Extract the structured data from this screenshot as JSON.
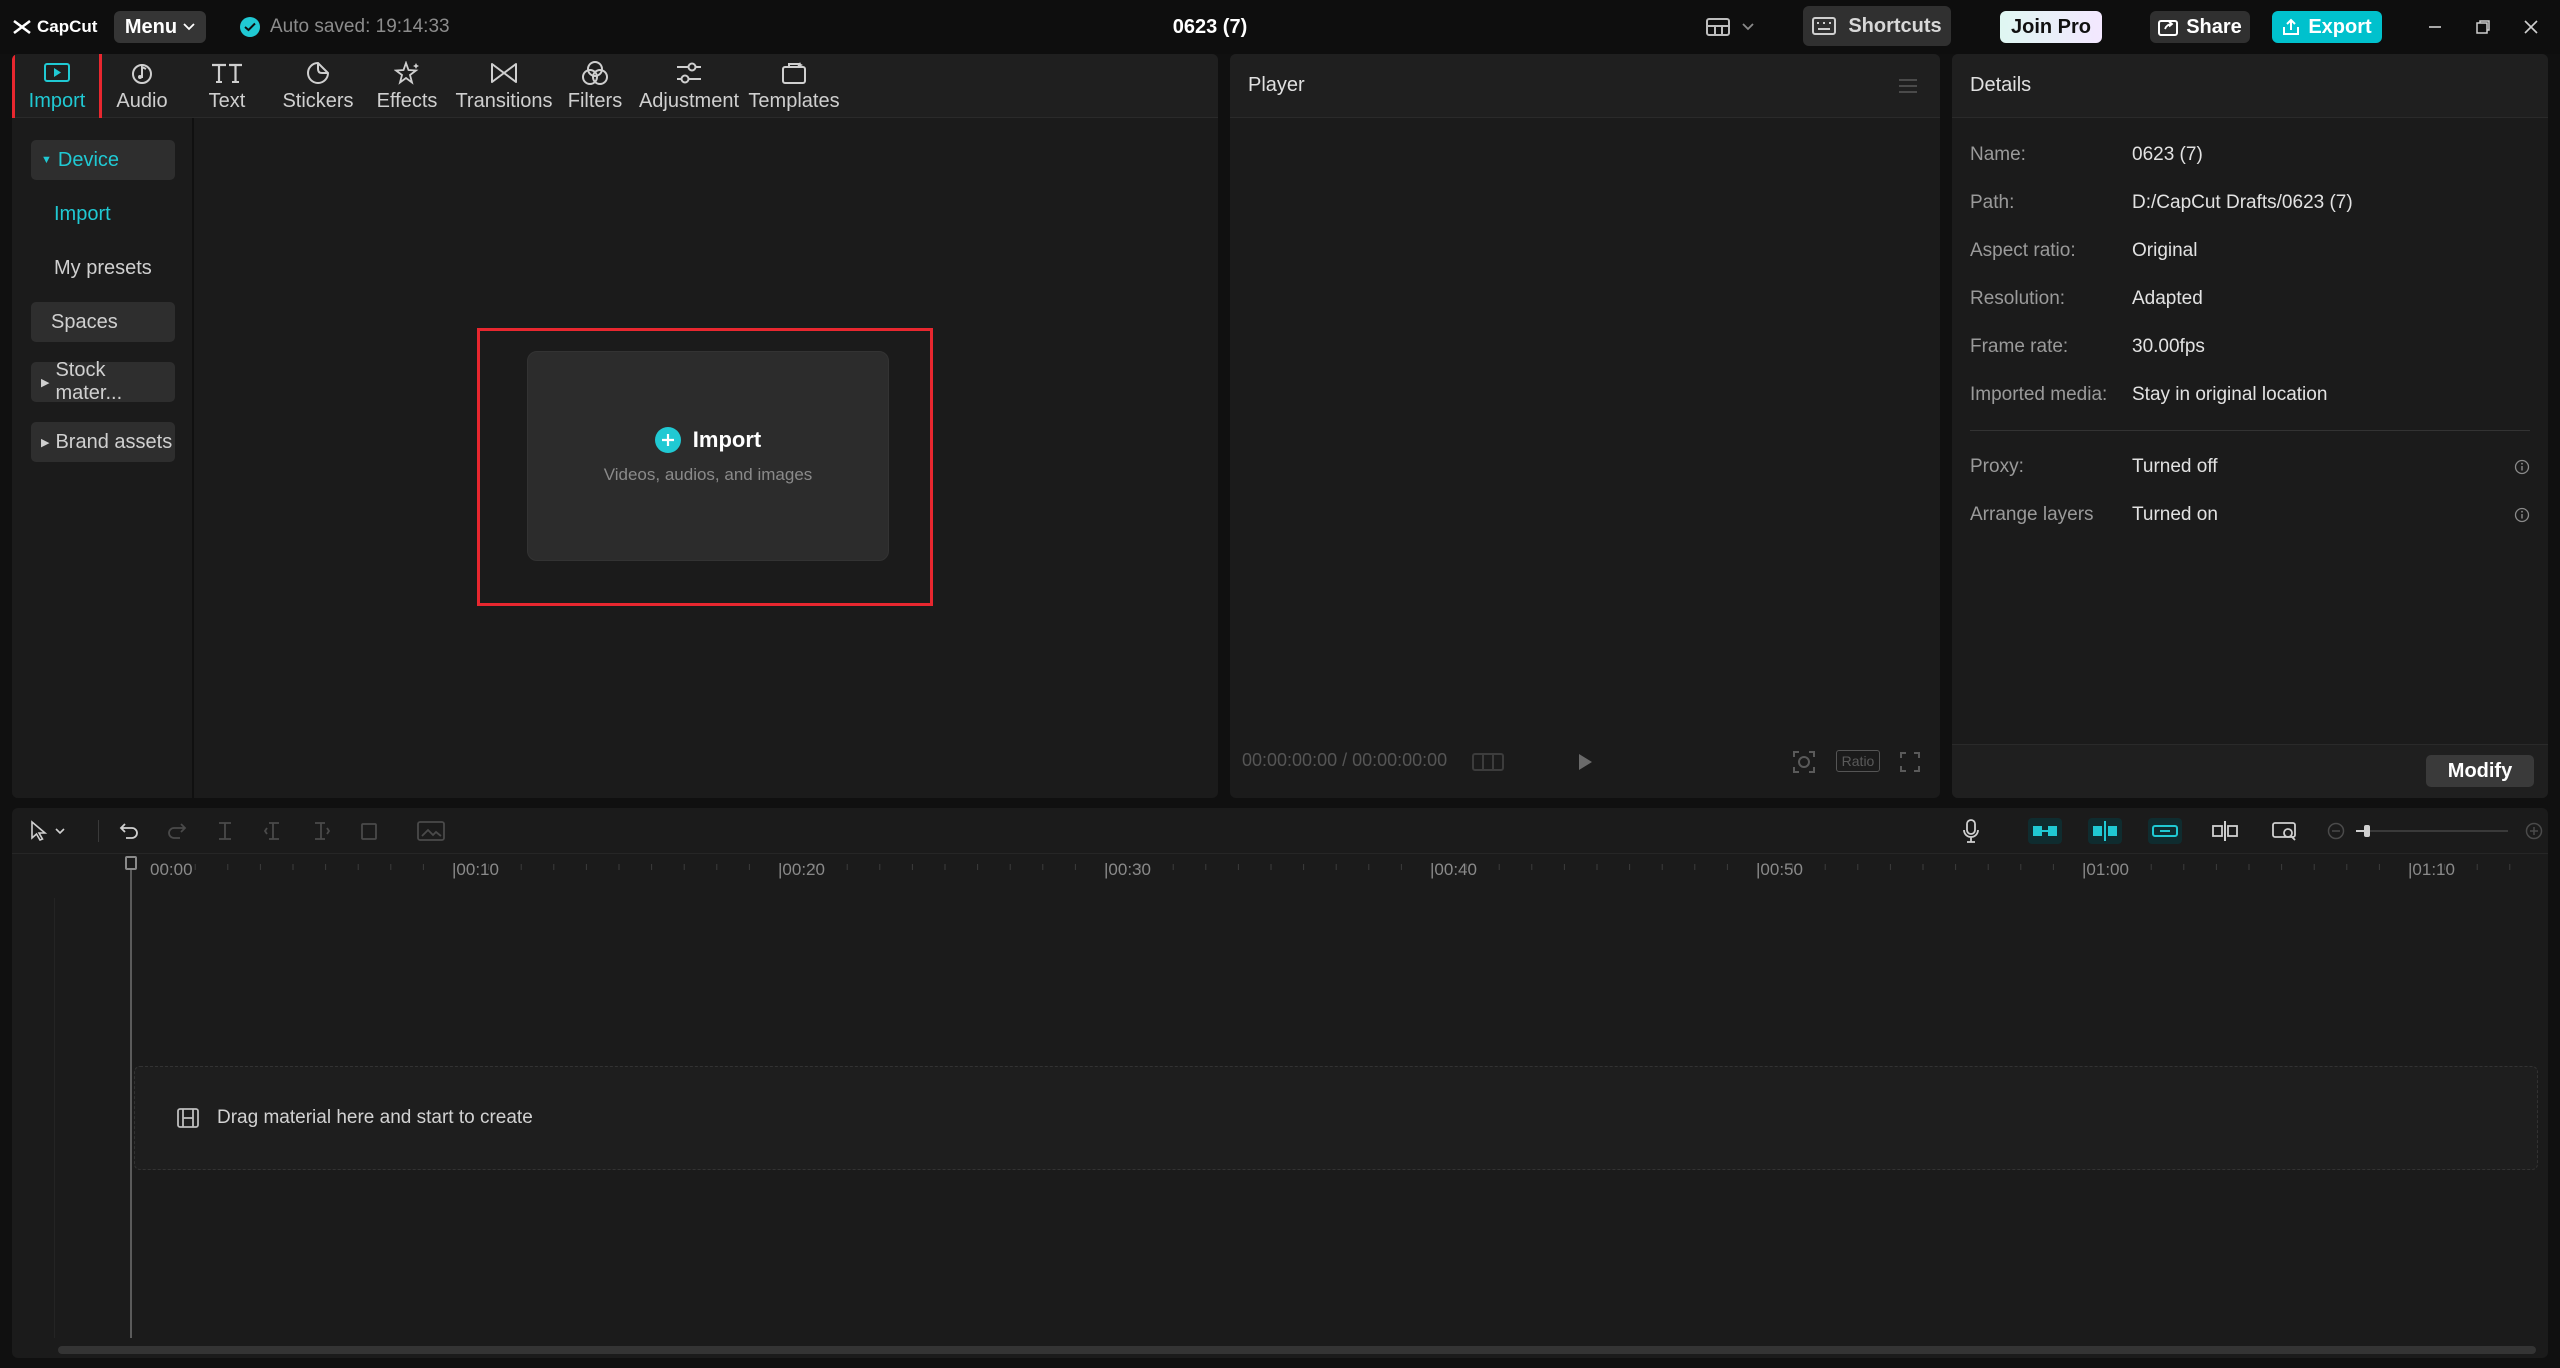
{
  "app": {
    "logo_text": "CapCut",
    "menu_label": "Menu",
    "autosave_text": "Auto saved: 19:14:33",
    "project_title": "0623 (7)",
    "shortcuts_label": "Shortcuts",
    "join_pro_label": "Join Pro",
    "share_label": "Share",
    "export_label": "Export"
  },
  "toolbar": {
    "tabs": [
      {
        "label": "Import"
      },
      {
        "label": "Audio"
      },
      {
        "label": "Text"
      },
      {
        "label": "Stickers"
      },
      {
        "label": "Effects"
      },
      {
        "label": "Transitions"
      },
      {
        "label": "Filters"
      },
      {
        "label": "Adjustment"
      },
      {
        "label": "Templates"
      }
    ]
  },
  "leftnav": {
    "device": "Device",
    "import": "Import",
    "my_presets": "My presets",
    "spaces": "Spaces",
    "stock_material": "Stock mater...",
    "brand_assets": "Brand assets"
  },
  "import_card": {
    "label": "Import",
    "sublabel": "Videos, audios, and images"
  },
  "player": {
    "title": "Player",
    "timecode": "00:00:00:00 / 00:00:00:00",
    "ratio_label": "Ratio"
  },
  "details": {
    "title": "Details",
    "rows": [
      {
        "key": "Name:",
        "value": "0623 (7)"
      },
      {
        "key": "Path:",
        "value": "D:/CapCut Drafts/0623 (7)"
      },
      {
        "key": "Aspect ratio:",
        "value": "Original"
      },
      {
        "key": "Resolution:",
        "value": "Adapted"
      },
      {
        "key": "Frame rate:",
        "value": "30.00fps"
      },
      {
        "key": "Imported media:",
        "value": "Stay in original location"
      },
      {
        "key": "Proxy:",
        "value": "Turned off"
      },
      {
        "key": "Arrange layers",
        "value": "Turned on"
      }
    ],
    "modify_label": "Modify"
  },
  "timeline": {
    "ruler": [
      "00:00",
      "|00:10",
      "|00:20",
      "|00:30",
      "|00:40",
      "|00:50",
      "|01:00",
      "|01:10"
    ],
    "drop_text": "Drag material here and start to create"
  },
  "colors": {
    "accent": "#20c9d3",
    "highlight": "#e8272f",
    "export": "#00c1cd"
  }
}
